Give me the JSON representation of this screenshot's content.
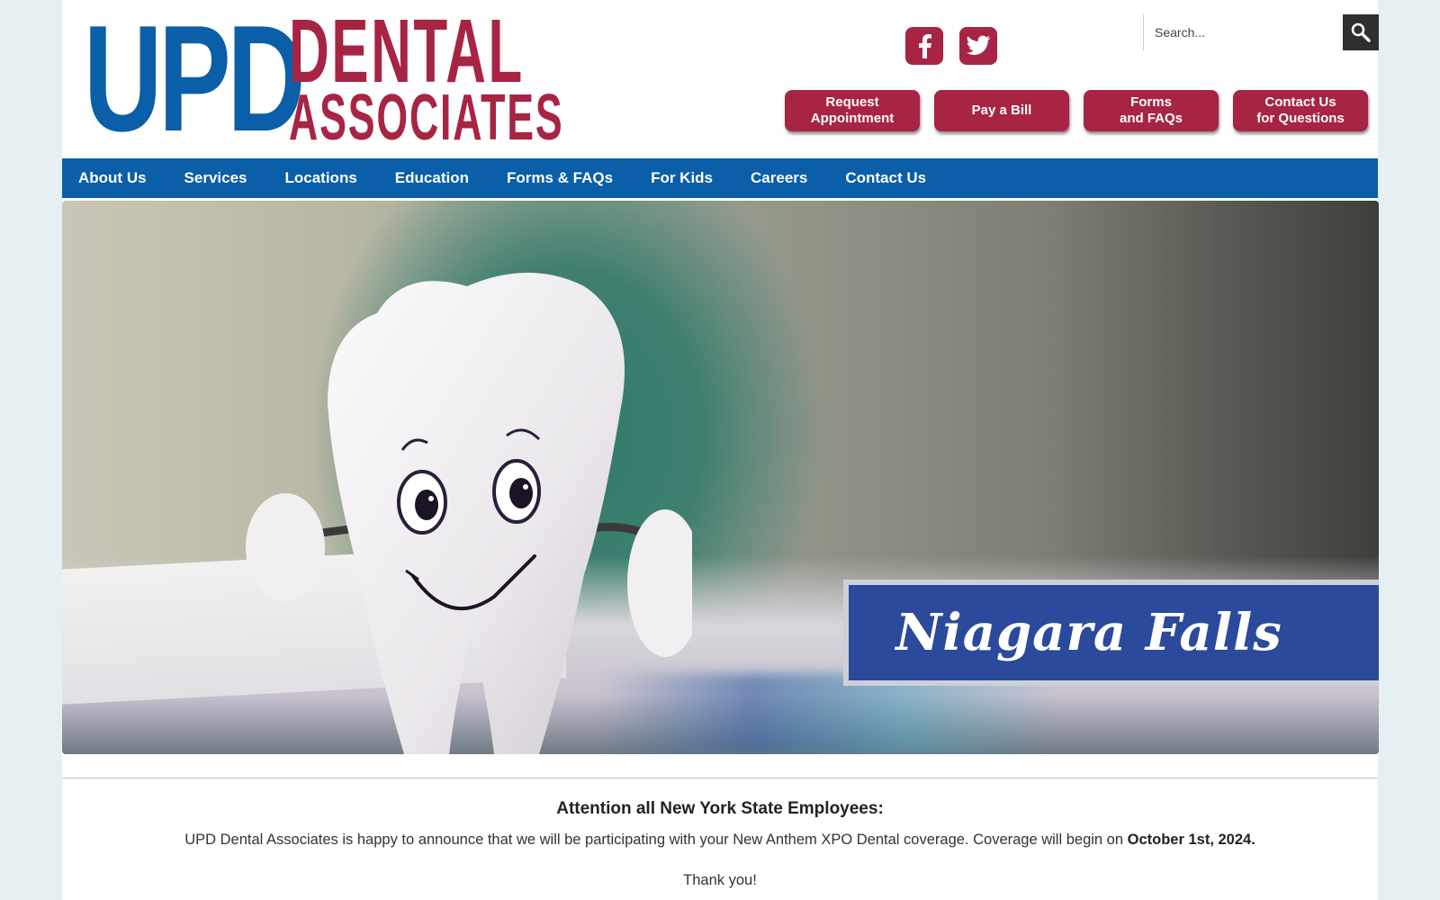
{
  "logo": {
    "upd": "UPD",
    "dental": "DENTAL",
    "associates": "ASSOCIATES"
  },
  "social": [
    {
      "name": "facebook-icon"
    },
    {
      "name": "twitter-icon"
    }
  ],
  "search": {
    "placeholder": "Search...",
    "icon": "search-icon"
  },
  "cta": [
    {
      "label": "Request\nAppointment"
    },
    {
      "label": "Pay a Bill"
    },
    {
      "label": "Forms\nand FAQs"
    },
    {
      "label": "Contact Us\nfor Questions"
    }
  ],
  "nav": [
    {
      "label": "About Us"
    },
    {
      "label": "Services"
    },
    {
      "label": "Locations"
    },
    {
      "label": "Education"
    },
    {
      "label": "Forms & FAQs"
    },
    {
      "label": "For Kids"
    },
    {
      "label": "Careers"
    },
    {
      "label": "Contact Us"
    }
  ],
  "hero": {
    "location": "Niagara Falls"
  },
  "announcement": {
    "title": "Attention all New York State Employees:",
    "body": "UPD Dental Associates is happy to announce that we will be participating with your New Anthem XPO Dental coverage. Coverage will begin on ",
    "date": "October 1st, 2024.",
    "thanks": "Thank you!"
  },
  "colors": {
    "brand_blue": "#0b5ea8",
    "brand_red": "#a82443",
    "banner_blue": "#2b4a9b"
  }
}
